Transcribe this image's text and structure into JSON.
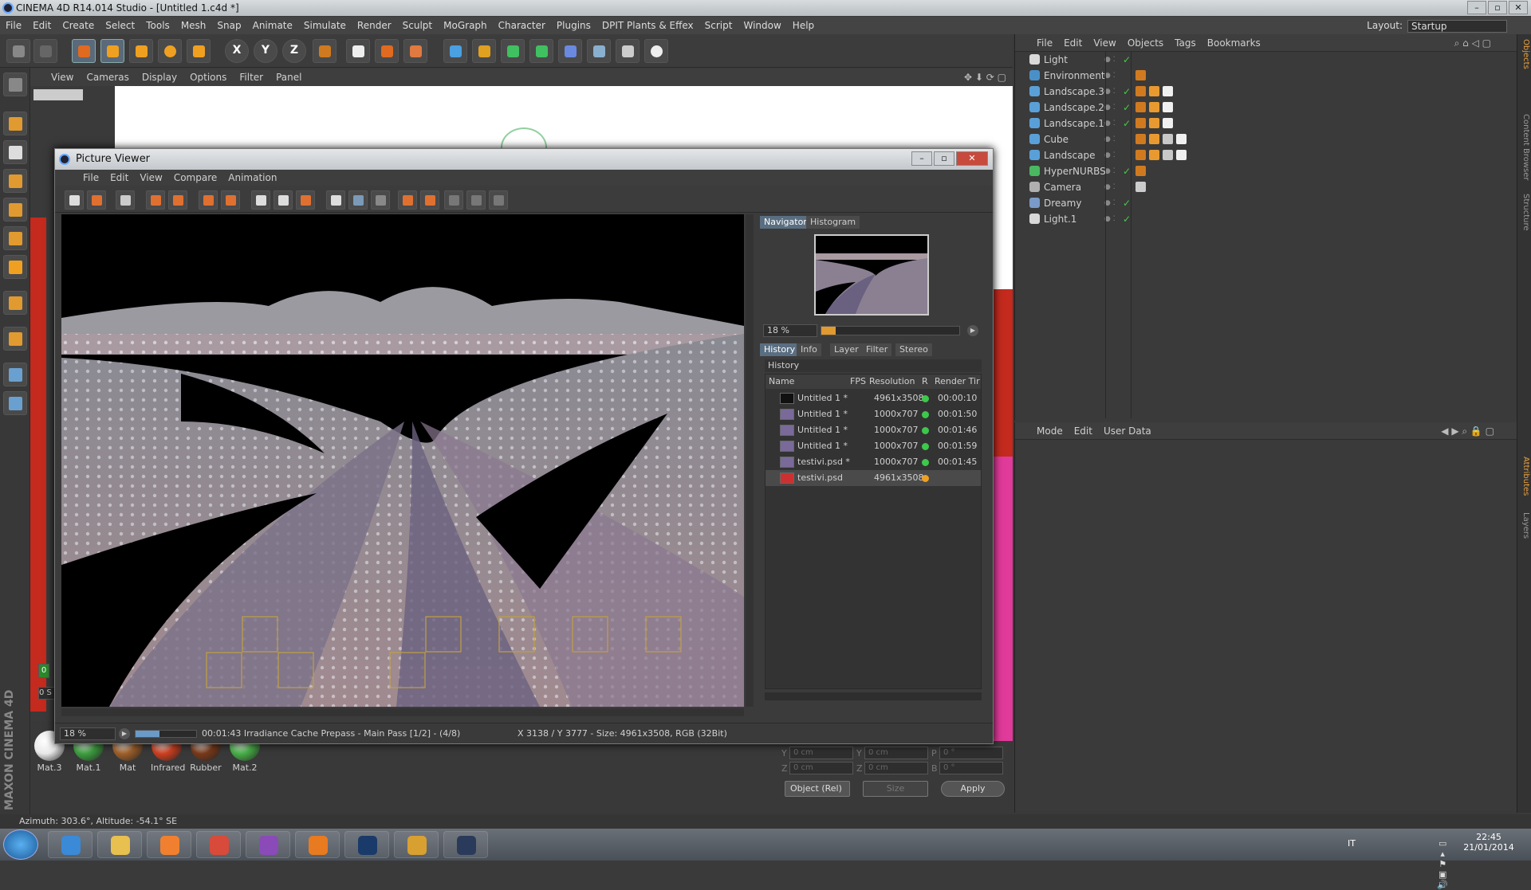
{
  "app": {
    "title": "CINEMA 4D R14.014 Studio - [Untitled 1.c4d *]",
    "layout_label": "Layout:",
    "layout_value": "Startup"
  },
  "menu": [
    "File",
    "Edit",
    "Create",
    "Select",
    "Tools",
    "Mesh",
    "Snap",
    "Animate",
    "Simulate",
    "Render",
    "Sculpt",
    "MoGraph",
    "Character",
    "Plugins",
    "DPIT Plants & Effex",
    "Script",
    "Window",
    "Help"
  ],
  "toolbar": [
    "undo-icon",
    "redo-icon",
    "select-icon",
    "move-icon",
    "scale-icon",
    "rotate-icon",
    "add-icon",
    "x-axis-icon",
    "y-axis-icon",
    "z-axis-icon",
    "coord-icon",
    "render-view-icon",
    "render-picture-viewer-icon",
    "render-settings-icon",
    "cube-icon",
    "spline-icon",
    "nurbs-icon",
    "array-icon",
    "deformer-icon",
    "floor-icon",
    "camera-icon",
    "light-icon"
  ],
  "axes": {
    "x": "X",
    "y": "Y",
    "z": "Z"
  },
  "viewport_menu": [
    "View",
    "Cameras",
    "Display",
    "Options",
    "Filter",
    "Panel"
  ],
  "materials": [
    {
      "name": "Mat.3",
      "color": "#e8e8e8"
    },
    {
      "name": "Mat.1",
      "color": "#3ea040"
    },
    {
      "name": "Mat",
      "color": "#a0602a"
    },
    {
      "name": "Infrared",
      "color": "#d04020"
    },
    {
      "name": "Rubber",
      "color": "#7a3a1a"
    },
    {
      "name": "Mat.2",
      "color": "#48b048"
    }
  ],
  "coords": {
    "rows": [
      {
        "l1": "Y",
        "v1": "0 cm",
        "l2": "Y",
        "v2": "0 cm",
        "l3": "P",
        "v3": "0 °"
      },
      {
        "l1": "Z",
        "v1": "0 cm",
        "l2": "Z",
        "v2": "0 cm",
        "l3": "B",
        "v3": "0 °"
      }
    ],
    "mode": "Object (Rel)",
    "size": "Size",
    "apply": "Apply"
  },
  "statusbar": "Azimuth: 303.6°, Altitude: -54.1°  SE",
  "maxon": "MAXON CINEMA 4D",
  "timeline": {
    "frame": "0",
    "frame_label": "0 S"
  },
  "object_manager": {
    "menu": [
      "File",
      "Edit",
      "View",
      "Objects",
      "Tags",
      "Bookmarks"
    ],
    "objects": [
      {
        "name": "Light",
        "icon": "#d8d8d8",
        "tags": []
      },
      {
        "name": "Environment",
        "icon": "#4a90c8",
        "tags": [
          "#d07a20"
        ]
      },
      {
        "name": "Landscape.3",
        "icon": "#5aa0d8",
        "tags": [
          "#d07a20",
          "#e89a30",
          "#f0f0f0"
        ]
      },
      {
        "name": "Landscape.2",
        "icon": "#5aa0d8",
        "tags": [
          "#d07a20",
          "#e89a30",
          "#f0f0f0"
        ]
      },
      {
        "name": "Landscape.1",
        "icon": "#5aa0d8",
        "tags": [
          "#d07a20",
          "#e89a30",
          "#f0f0f0"
        ]
      },
      {
        "name": "Cube",
        "icon": "#5aa0d8",
        "tags": [
          "#d07a20",
          "#e89a30",
          "#c8c8c8",
          "#f0f0f0"
        ]
      },
      {
        "name": "Landscape",
        "icon": "#5aa0d8",
        "tags": [
          "#d07a20",
          "#e89a30",
          "#c8c8c8",
          "#f0f0f0"
        ]
      },
      {
        "name": "HyperNURBS",
        "icon": "#4ab860",
        "tags": [
          "#d07a20"
        ]
      },
      {
        "name": "Camera",
        "icon": "#b0b0b0",
        "tags": [
          "#cccccc"
        ]
      },
      {
        "name": "Dreamy",
        "icon": "#7a9ac8",
        "tags": []
      },
      {
        "name": "Light.1",
        "icon": "#d8d8d8",
        "tags": []
      }
    ],
    "checks": [
      "✓",
      "",
      "✓",
      "✓",
      "✓",
      "",
      "",
      "✓",
      "",
      "✓",
      "✓"
    ]
  },
  "attribute_manager": {
    "menu": [
      "Mode",
      "Edit",
      "User Data"
    ]
  },
  "right_tabs": [
    "Objects",
    "Content Browser",
    "Structure",
    "Attributes",
    "Layers"
  ],
  "picture_viewer": {
    "title": "Picture Viewer",
    "menu": [
      "File",
      "Edit",
      "View",
      "Compare",
      "Animation"
    ],
    "top_tabs": [
      "Navigator",
      "Histogram"
    ],
    "zoom": "18 %",
    "bottom_tabs": [
      "History",
      "Info",
      "Layer",
      "Filter",
      "Stereo"
    ],
    "history_label": "History",
    "columns": [
      "Name",
      "FPS",
      "Resolution",
      "R",
      "Render Tir"
    ],
    "history": [
      {
        "name": "Untitled 1 *",
        "res": "4961x3508",
        "status": "#3cc84a",
        "time": "00:00:10",
        "thumb": "#111111"
      },
      {
        "name": "Untitled 1 *",
        "res": "1000x707",
        "status": "#3cc84a",
        "time": "00:01:50",
        "thumb": "#7a6a9a"
      },
      {
        "name": "Untitled 1 *",
        "res": "1000x707",
        "status": "#3cc84a",
        "time": "00:01:46",
        "thumb": "#7a6a9a"
      },
      {
        "name": "Untitled 1 *",
        "res": "1000x707",
        "status": "#3cc84a",
        "time": "00:01:59",
        "thumb": "#7a6a9a"
      },
      {
        "name": "testivi.psd *",
        "res": "1000x707",
        "status": "#3cc84a",
        "time": "00:01:45",
        "thumb": "#7a6a9a"
      },
      {
        "name": "testivi.psd",
        "res": "4961x3508",
        "status": "#f0a020",
        "time": "",
        "thumb": "#cc3030"
      }
    ],
    "status_zoom": "18 %",
    "status_text": "00:01:43 Irradiance Cache Prepass - Main Pass [1/2] - (4/8)",
    "status_info": "X 3138 / Y 3777 - Size: 4961x3508, RGB (32Bit)"
  },
  "taskbar": {
    "apps": [
      {
        "name": "ie-icon",
        "color": "#3a8ad8"
      },
      {
        "name": "explorer-icon",
        "color": "#e8c050"
      },
      {
        "name": "media-player-icon",
        "color": "#f08030"
      },
      {
        "name": "chrome-icon",
        "color": "#d84a3a"
      },
      {
        "name": "viber-icon",
        "color": "#8a4ab8"
      },
      {
        "name": "firefox-icon",
        "color": "#e87a20"
      },
      {
        "name": "photoshop-icon",
        "color": "#1a3a6a"
      },
      {
        "name": "folder-icon",
        "color": "#d8a030"
      },
      {
        "name": "cinema4d-icon",
        "color": "#2a3a5a"
      }
    ],
    "lang": "IT",
    "time": "22:45",
    "date": "21/01/2014"
  }
}
